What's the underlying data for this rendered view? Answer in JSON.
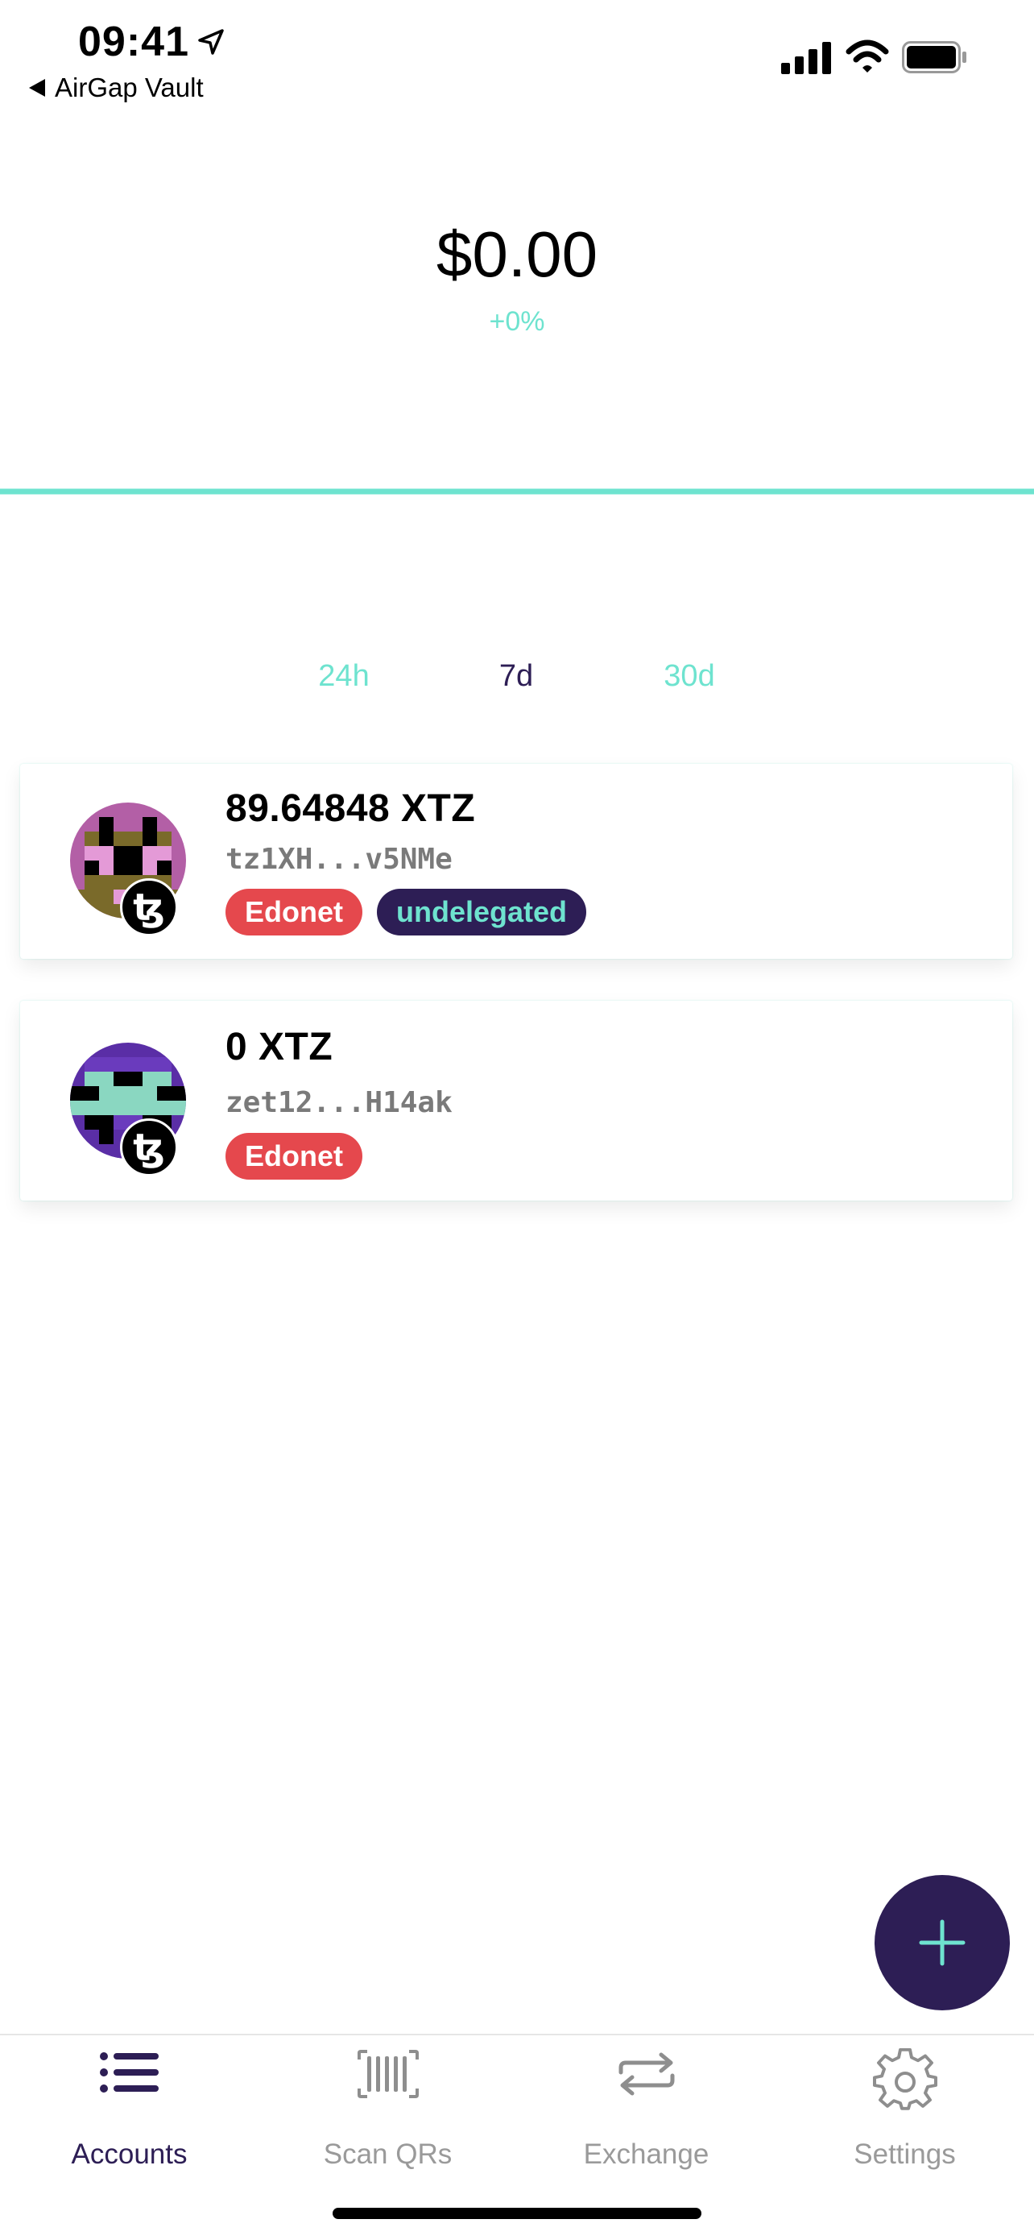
{
  "status_bar": {
    "time": "09:41",
    "back_app": "AirGap Vault"
  },
  "portfolio": {
    "total": "$0.00",
    "change": "+0%"
  },
  "periods": [
    {
      "label": "24h",
      "active": false
    },
    {
      "label": "7d",
      "active": true
    },
    {
      "label": "30d",
      "active": false
    }
  ],
  "accounts": [
    {
      "balance": "89.64848 XTZ",
      "address": "tz1XH...v5NMe",
      "tags": [
        "Edonet",
        "undelegated"
      ],
      "coin_icon": "tezos-icon"
    },
    {
      "balance": "0 XTZ",
      "address": "zet12...H14ak",
      "tags": [
        "Edonet"
      ],
      "coin_icon": "tezos-shielded-icon"
    }
  ],
  "tabbar": {
    "accounts": "Accounts",
    "scan": "Scan QRs",
    "exchange": "Exchange",
    "settings": "Settings"
  },
  "colors": {
    "brand_dark": "#2d1e55",
    "accent_teal": "#6ee3cf",
    "tag_red": "#e5484d"
  }
}
